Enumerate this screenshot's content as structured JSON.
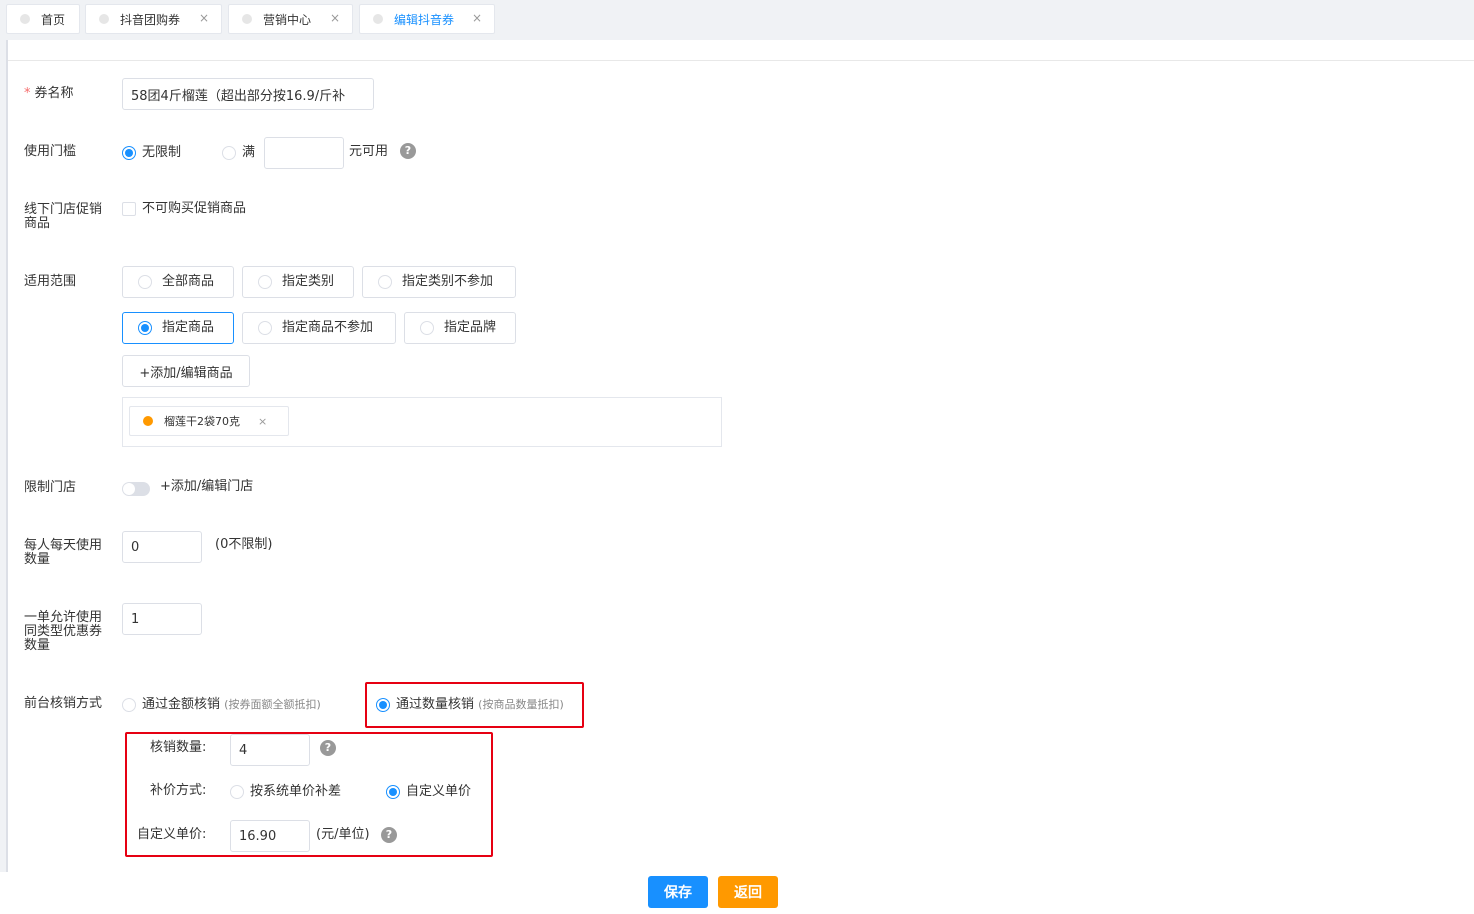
{
  "tabs": [
    {
      "label": "首页",
      "closable": false
    },
    {
      "label": "抖音团购券",
      "closable": true
    },
    {
      "label": "营销中心",
      "closable": true
    },
    {
      "label": "编辑抖音券",
      "closable": true,
      "active": true
    }
  ],
  "tab_close_glyph": "×",
  "form": {
    "name": {
      "required_mark": "*",
      "label": "券名称",
      "value": "58团4斤榴莲（超出部分按16.9/斤补"
    },
    "threshold": {
      "label": "使用门槛",
      "opt_unlimited": "无限制",
      "opt_full": "满",
      "full_value": "",
      "suffix": "元可用",
      "selected": "unlimited"
    },
    "offline_promo": {
      "label_line1": "线下门店促销",
      "label_line2": "商品",
      "checkbox_label": "不可购买促销商品",
      "checked": false
    },
    "scope": {
      "label": "适用范围",
      "options": [
        "全部商品",
        "指定类别",
        "指定类别不参加",
        "指定商品",
        "指定商品不参加",
        "指定品牌"
      ],
      "selected": "指定商品",
      "add_button": "+添加/编辑商品",
      "tags": [
        "榴莲干2袋70克"
      ]
    },
    "store_limit": {
      "label": "限制门店",
      "enabled": false,
      "add_link": "+添加/编辑门店"
    },
    "daily_limit": {
      "label_line1": "每人每天使用",
      "label_line2": "数量",
      "value": "0",
      "hint": "(0不限制)"
    },
    "order_limit": {
      "label_line1": "一单允许使用",
      "label_line2": "同类型优惠券",
      "label_line3": "数量",
      "value": "1"
    },
    "redeem": {
      "label": "前台核销方式",
      "opt_amount": "通过金额核销",
      "opt_amount_hint": "(按券面额全额抵扣)",
      "opt_qty": "通过数量核销",
      "opt_qty_hint": "(按商品数量抵扣)",
      "selected": "qty",
      "qty_label": "核销数量:",
      "qty_value": "4",
      "price_mode_label": "补价方式:",
      "price_opt_system": "按系统单价补差",
      "price_opt_custom": "自定义单价",
      "price_selected": "custom",
      "custom_price_label": "自定义单价:",
      "custom_price_value": "16.90",
      "custom_price_unit": "(元/单位)"
    }
  },
  "help_glyph": "?",
  "footer": {
    "save": "保存",
    "back": "返回"
  },
  "colors": {
    "primary": "#1890ff",
    "warning": "#ff9900",
    "highlight": "#e60012",
    "required": "#f56c6c"
  }
}
